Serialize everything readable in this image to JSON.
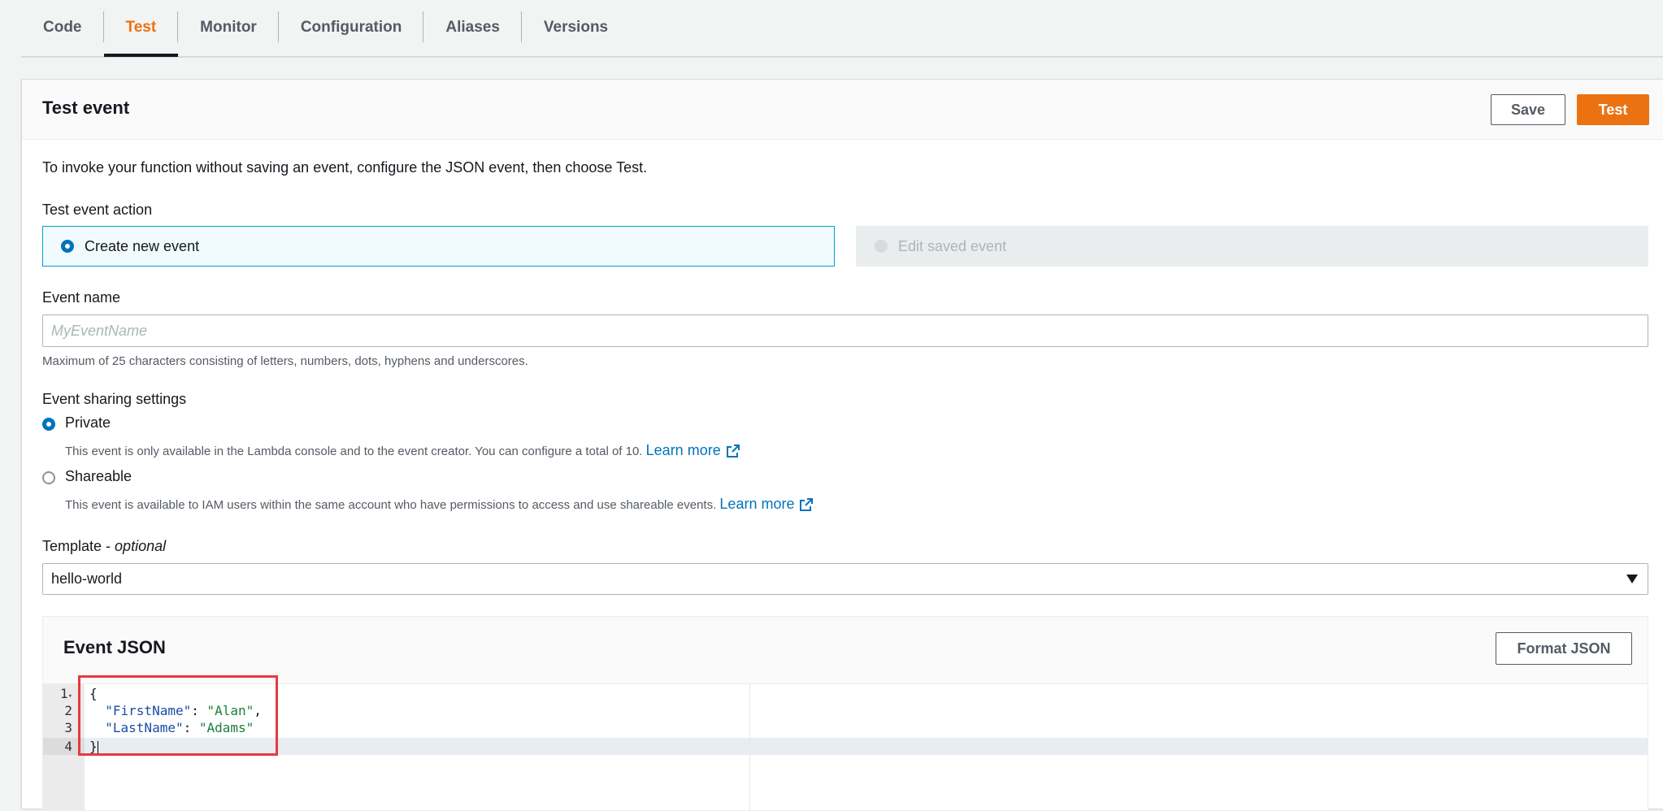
{
  "tabs": [
    {
      "label": "Code",
      "active": false
    },
    {
      "label": "Test",
      "active": true
    },
    {
      "label": "Monitor",
      "active": false
    },
    {
      "label": "Configuration",
      "active": false
    },
    {
      "label": "Aliases",
      "active": false
    },
    {
      "label": "Versions",
      "active": false
    }
  ],
  "panel": {
    "title": "Test event",
    "save_label": "Save",
    "test_label": "Test",
    "intro": "To invoke your function without saving an event, configure the JSON event, then choose Test."
  },
  "action": {
    "label": "Test event action",
    "create_label": "Create new event",
    "edit_label": "Edit saved event",
    "selected": "create"
  },
  "event_name": {
    "label": "Event name",
    "placeholder": "MyEventName",
    "value": "",
    "hint": "Maximum of 25 characters consisting of letters, numbers, dots, hyphens and underscores."
  },
  "sharing": {
    "label": "Event sharing settings",
    "selected": "private",
    "private": {
      "label": "Private",
      "description": "This event is only available in the Lambda console and to the event creator. You can configure a total of 10.",
      "link": "Learn more"
    },
    "shareable": {
      "label": "Shareable",
      "description": "This event is available to IAM users within the same account who have permissions to access and use shareable events.",
      "link": "Learn more"
    }
  },
  "template": {
    "label": "Template - ",
    "optional": "optional",
    "selected": "hello-world"
  },
  "event_json": {
    "title": "Event JSON",
    "format_label": "Format JSON",
    "line_numbers": [
      "1",
      "2",
      "3",
      "4"
    ],
    "lines": [
      {
        "brace": "{"
      },
      {
        "indent": "  ",
        "key": "\"FirstName\"",
        "sep": ": ",
        "value": "\"Alan\"",
        "end": ","
      },
      {
        "indent": "  ",
        "key": "\"LastName\"",
        "sep": ": ",
        "value": "\"Adams\"",
        "end": ""
      },
      {
        "brace": "}"
      }
    ]
  },
  "colors": {
    "accent": "#ec7211",
    "link": "#0073bb",
    "highlight": "#e8393f"
  }
}
